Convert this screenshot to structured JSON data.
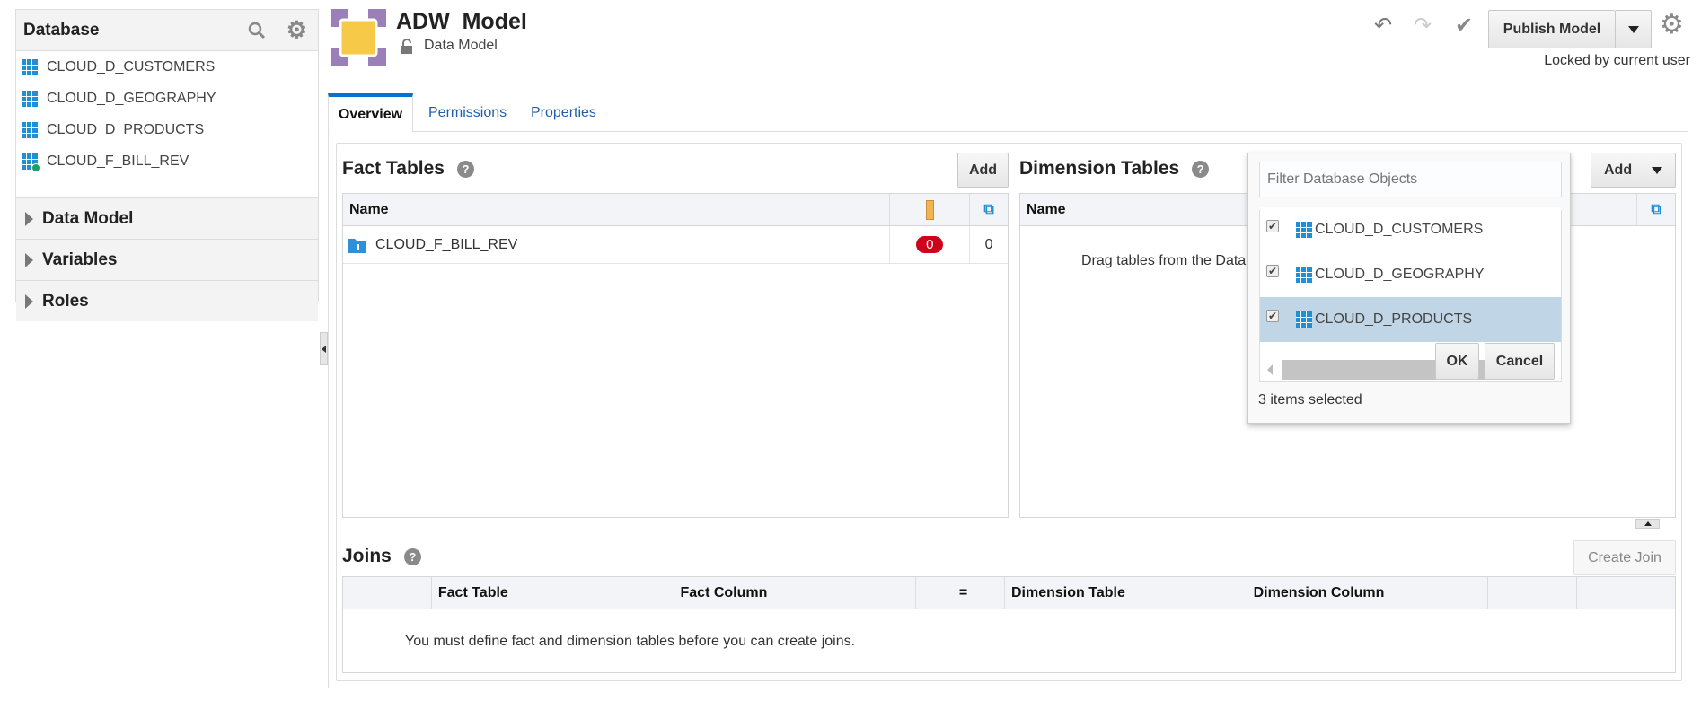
{
  "sidebar": {
    "title": "Database",
    "items": [
      {
        "label": "CLOUD_D_CUSTOMERS",
        "icon": "table-icon"
      },
      {
        "label": "CLOUD_D_GEOGRAPHY",
        "icon": "table-icon"
      },
      {
        "label": "CLOUD_D_PRODUCTS",
        "icon": "table-icon"
      },
      {
        "label": "CLOUD_F_BILL_REV",
        "icon": "table-used-icon"
      }
    ],
    "sections": [
      "Data Model",
      "Variables",
      "Roles"
    ]
  },
  "header": {
    "title": "ADW_Model",
    "subtitle": "Data Model",
    "publish_label": "Publish Model",
    "lock_status": "Locked by current user"
  },
  "tabs": [
    "Overview",
    "Permissions",
    "Properties"
  ],
  "fact": {
    "title": "Fact Tables",
    "add_label": "Add",
    "col_name": "Name",
    "rows": [
      {
        "name": "CLOUD_F_BILL_REV",
        "badge": "0",
        "count": "0"
      }
    ]
  },
  "dimension": {
    "title": "Dimension Tables",
    "add_label": "Add",
    "col_name": "Name",
    "empty": "Drag tables from the Data"
  },
  "popup": {
    "placeholder": "Filter Database Objects",
    "items": [
      {
        "label": "CLOUD_D_CUSTOMERS",
        "checked": true
      },
      {
        "label": "CLOUD_D_GEOGRAPHY",
        "checked": true
      },
      {
        "label": "CLOUD_D_PRODUCTS",
        "checked": true,
        "selected": true
      }
    ],
    "status": "3 items selected",
    "ok": "OK",
    "cancel": "Cancel"
  },
  "joins": {
    "title": "Joins",
    "create_label": "Create Join",
    "columns": [
      "",
      "Fact Table",
      "Fact Column",
      "=",
      "Dimension Table",
      "Dimension Column",
      "",
      ""
    ],
    "empty": "You must define fact and dimension tables before you can create joins."
  },
  "colors": {
    "accent": "#0572ce",
    "link": "#1f5fa8",
    "badge": "#d0021b",
    "selected_row": "#c0d5e6"
  }
}
